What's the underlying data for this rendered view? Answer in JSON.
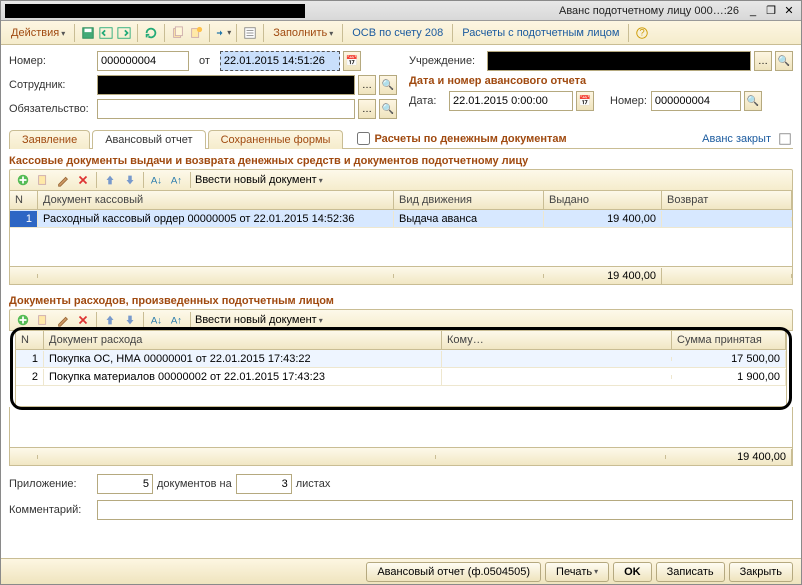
{
  "window": {
    "title": "Аванс подотчетному лицу 000…:26",
    "minimize": "_",
    "restore": "❐",
    "close": "✕"
  },
  "toolbar": {
    "actions": "Действия",
    "fill": "Заполнить",
    "osv": "ОСВ по счету 208",
    "calc": "Расчеты с подотчетным лицом",
    "help": "?"
  },
  "header": {
    "number_label": "Номер:",
    "number_value": "000000004",
    "from_label": "от",
    "datetime": "22.01.2015 14:51:26",
    "employee_label": "Сотрудник:",
    "obligation_label": "Обязательство:",
    "institution_label": "Учреждение:",
    "report_heading": "Дата и номер авансового отчета",
    "date_label": "Дата:",
    "date_value": "22.01.2015 0:00:00",
    "number2_label": "Номер:",
    "number2_value": "000000004"
  },
  "tabs": {
    "t1": "Заявление",
    "t2": "Авансовый отчет",
    "t3": "Сохраненные формы",
    "check_label": "Расчеты по денежным документам",
    "right": "Аванс закрыт"
  },
  "section1": {
    "title": "Кассовые документы выдачи и возврата денежных средств и документов подотчетному лицу",
    "enter_new": "Ввести новый документ",
    "cols": {
      "n": "N",
      "doc": "Документ кассовый",
      "type": "Вид движения",
      "issued": "Выдано",
      "ret": "Возврат"
    },
    "rows": [
      {
        "n": "1",
        "doc": "Расходный кассовый ордер 00000005 от 22.01.2015 14:52:36",
        "type": "Выдача аванса",
        "issued": "19 400,00",
        "ret": ""
      }
    ],
    "total": "19 400,00"
  },
  "section2": {
    "title": "Документы расходов, произведенных подотчетным лицом",
    "enter_new": "Ввести новый документ",
    "cols": {
      "n": "N",
      "doc": "Документ расхода",
      "to": "Кому…",
      "sum": "Сумма принятая"
    },
    "rows": [
      {
        "n": "1",
        "doc": "Покупка ОС, НМА 00000001 от 22.01.2015 17:43:22",
        "to": "",
        "sum": "17 500,00"
      },
      {
        "n": "2",
        "doc": "Покупка материалов 00000002 от 22.01.2015 17:43:23",
        "to": "",
        "sum": "1 900,00"
      }
    ],
    "total": "19 400,00"
  },
  "bottom": {
    "attach_label": "Приложение:",
    "attach_count": "5",
    "docs_on": "документов на",
    "sheets_count": "3",
    "sheets": "листах",
    "comment_label": "Комментарий:"
  },
  "footer": {
    "form": "Авансовый отчет (ф.0504505)",
    "print": "Печать",
    "ok": "OK",
    "save": "Записать",
    "close": "Закрыть"
  }
}
